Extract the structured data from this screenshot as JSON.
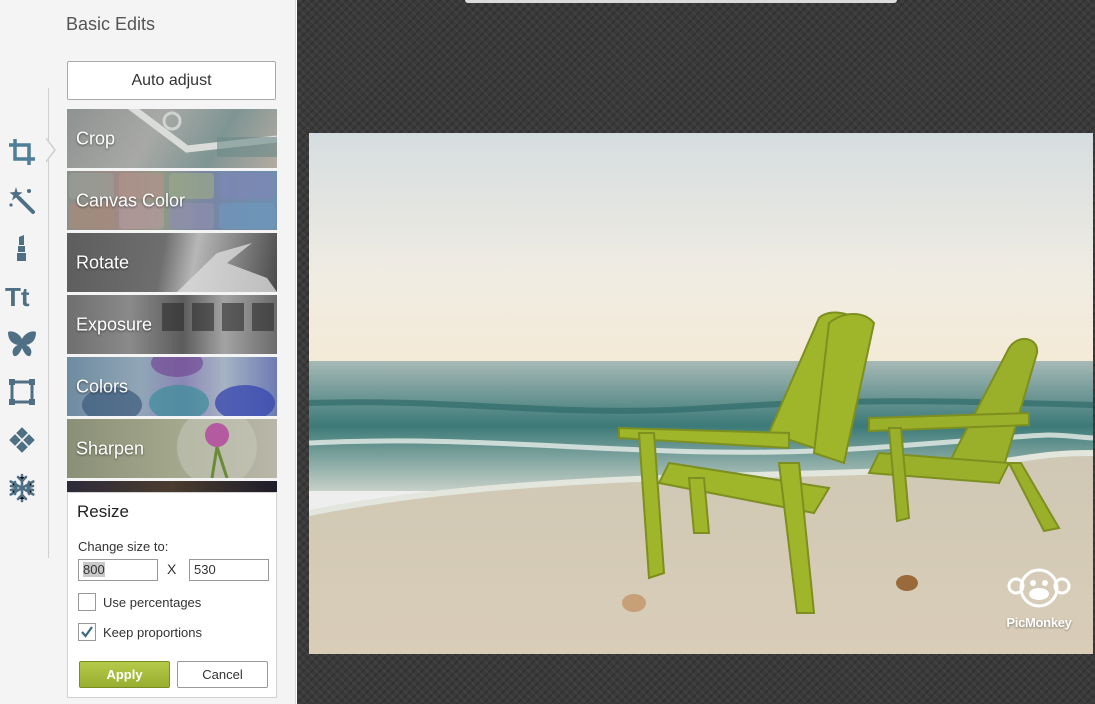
{
  "panel": {
    "title": "Basic Edits",
    "auto_adjust_label": "Auto adjust",
    "items": [
      {
        "label": "Crop"
      },
      {
        "label": "Canvas Color"
      },
      {
        "label": "Rotate"
      },
      {
        "label": "Exposure"
      },
      {
        "label": "Colors"
      },
      {
        "label": "Sharpen"
      }
    ]
  },
  "tools": [
    "crop-icon",
    "magic-wand-icon",
    "lipstick-icon",
    "text-icon",
    "butterfly-icon",
    "frame-icon",
    "texture-icon",
    "snowflake-icon"
  ],
  "resize": {
    "title": "Resize",
    "change_label": "Change size to:",
    "width": "800",
    "height": "530",
    "separator": "X",
    "use_percentages_label": "Use percentages",
    "use_percentages_checked": false,
    "keep_proportions_label": "Keep proportions",
    "keep_proportions_checked": true,
    "apply_label": "Apply",
    "cancel_label": "Cancel"
  },
  "canvas": {
    "watermark": "PicMonkey"
  },
  "colors": {
    "accent": "#a7bc3a",
    "icon": "#4f6f85",
    "canvas_bg": "#3a3a3a"
  }
}
